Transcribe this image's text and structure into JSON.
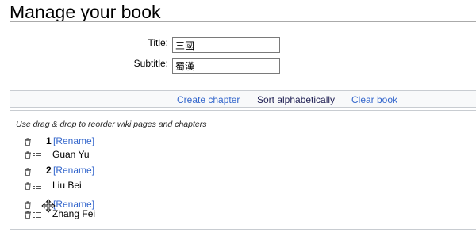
{
  "page": {
    "title": "Manage your book"
  },
  "form": {
    "title_label": "Title:",
    "title_value": "三國",
    "subtitle_label": "Subtitle:",
    "subtitle_value": "蜀漢"
  },
  "toolbar": {
    "create_chapter": "Create chapter",
    "sort_alphabetically": "Sort alphabetically",
    "clear_book": "Clear book"
  },
  "list": {
    "instructions": "Use drag & drop to reorder wiki pages and chapters",
    "rename_label": "[Rename]",
    "chapters": [
      {
        "number": "1",
        "pages": [
          "Guan Yu"
        ]
      },
      {
        "number": "2",
        "pages": [
          "Liu Bei"
        ]
      },
      {
        "number": "",
        "pages": [
          "Zhang Fei"
        ]
      }
    ]
  },
  "icons": {
    "remove": "trash-icon",
    "page": "list-icon",
    "drag": "move-cursor-icon"
  },
  "colors": {
    "link": "#3366cc",
    "border": "#c8ccd1",
    "toolbar_bg": "#f8f9fa"
  }
}
